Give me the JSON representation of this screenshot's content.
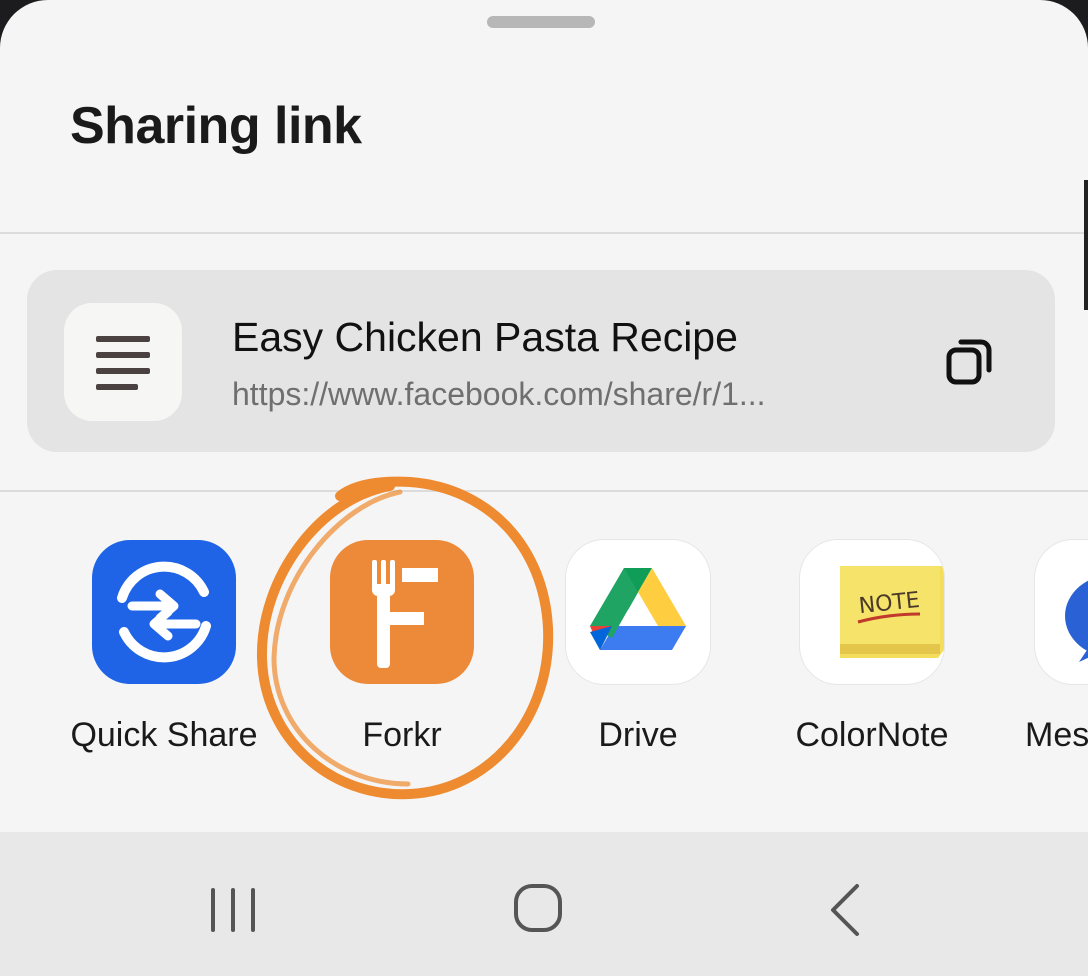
{
  "sheet": {
    "title": "Sharing link"
  },
  "link_preview": {
    "title": "Easy Chicken Pasta Recipe",
    "url": "https://www.facebook.com/share/r/1..."
  },
  "apps": [
    {
      "label": "Quick Share",
      "icon": "quick-share-icon"
    },
    {
      "label": "Forkr",
      "icon": "forkr-icon",
      "highlighted": true
    },
    {
      "label": "Drive",
      "icon": "google-drive-icon"
    },
    {
      "label": "ColorNote",
      "icon": "colornote-icon",
      "icon_text": "NOTE"
    },
    {
      "label": "Mes",
      "icon": "messages-icon"
    }
  ],
  "nav_bar": {
    "buttons": [
      "recent-apps-icon",
      "home-icon",
      "back-icon"
    ]
  },
  "colors": {
    "quick_share": "#1f64e7",
    "forkr": "#ed8a39",
    "highlight_circle": "#ee8a2f",
    "sheet_bg": "#f5f5f5",
    "card_bg": "#e4e4e4"
  }
}
